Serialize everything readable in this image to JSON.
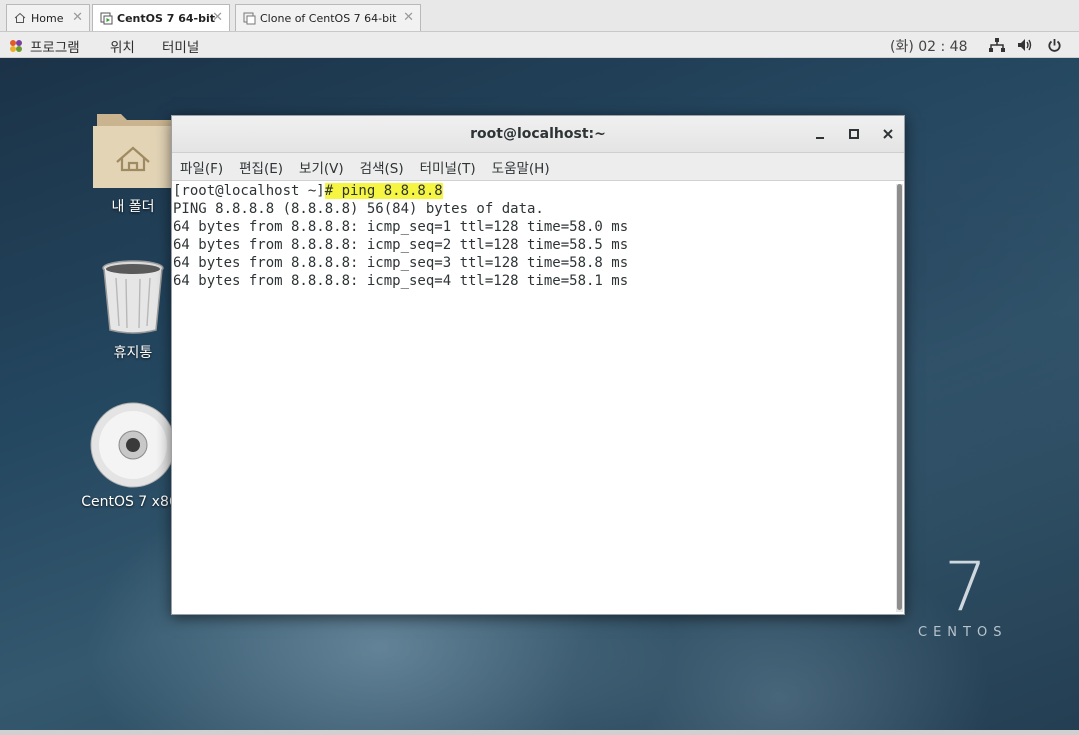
{
  "tabs": [
    {
      "label": "Home",
      "icon": "home-icon",
      "active": false
    },
    {
      "label": "CentOS 7 64-bit",
      "icon": "vm-running-icon",
      "active": true
    },
    {
      "label": "Clone of CentOS 7 64-bit",
      "icon": "vm-icon",
      "active": false
    }
  ],
  "panel": {
    "menus": [
      "프로그램",
      "위치",
      "터미널"
    ],
    "clock": "(화) 02 : 48",
    "tray_icons": [
      "network-icon",
      "volume-icon",
      "power-icon"
    ]
  },
  "desktop": {
    "icons": [
      {
        "label": "내 폴더",
        "icon": "home-folder-icon"
      },
      {
        "label": "휴지통",
        "icon": "trash-icon"
      },
      {
        "label": "CentOS 7 x86_",
        "icon": "disc-icon"
      }
    ],
    "brand": {
      "number": "7",
      "word": "CENTOS"
    }
  },
  "terminal": {
    "title": "root@localhost:~",
    "menu": [
      "파일(F)",
      "편집(E)",
      "보기(V)",
      "검색(S)",
      "터미널(T)",
      "도움말(H)"
    ],
    "prompt": "[root@localhost ~]",
    "command": "# ping 8.8.8.8",
    "output": [
      "PING 8.8.8.8 (8.8.8.8) 56(84) bytes of data.",
      "64 bytes from 8.8.8.8: icmp_seq=1 ttl=128 time=58.0 ms",
      "64 bytes from 8.8.8.8: icmp_seq=2 ttl=128 time=58.5 ms",
      "64 bytes from 8.8.8.8: icmp_seq=3 ttl=128 time=58.8 ms",
      "64 bytes from 8.8.8.8: icmp_seq=4 ttl=128 time=58.1 ms"
    ],
    "highlight_color": "#f5f542"
  }
}
